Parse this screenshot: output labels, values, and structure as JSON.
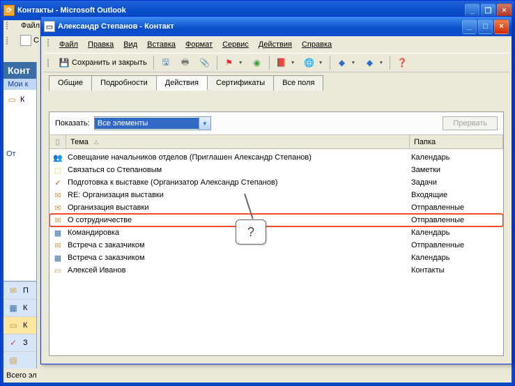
{
  "bg": {
    "title": "Контакты - Microsoft Outlook",
    "menu_file": "Файл",
    "toolbar_btn": "С",
    "side_header": "Конт",
    "side_sub": "Мои к",
    "side_item1": "К",
    "side_current": "От",
    "nav": {
      "mail": "П",
      "cal": "К",
      "contacts": "К",
      "tasks": "З"
    },
    "status": "Всего эл"
  },
  "dlg": {
    "title": "Александр Степанов - Контакт",
    "menu": {
      "file": "Файл",
      "edit": "Правка",
      "view": "Вид",
      "insert": "Вставка",
      "format": "Формат",
      "service": "Сервис",
      "actions": "Действия",
      "help": "Справка"
    },
    "toolbar": {
      "save_close": "Сохранить и закрыть"
    },
    "tabs": {
      "general": "Общие",
      "details": "Подробности",
      "actions": "Действия",
      "certs": "Сертификаты",
      "all": "Все поля"
    },
    "filter": {
      "label": "Показать:",
      "value": "Все элементы",
      "stop": "Прервать"
    },
    "headers": {
      "subject": "Тема",
      "folder": "Папка"
    },
    "rows": [
      {
        "icon": "meeting",
        "subject": "Совещание начальников отделов (Приглашен Александр Степанов)",
        "folder": "Календарь"
      },
      {
        "icon": "note",
        "subject": "Связаться со Степановым",
        "folder": "Заметки"
      },
      {
        "icon": "task",
        "subject": "Подготовка к выставке (Организатор Александр Степанов)",
        "folder": "Задачи"
      },
      {
        "icon": "mail-in",
        "subject": "RE: Организация выставки",
        "folder": "Входящие"
      },
      {
        "icon": "mail-out",
        "subject": "Организация выставки",
        "folder": "Отправленные"
      },
      {
        "icon": "mail-out",
        "subject": "О сотрудничестве",
        "folder": "Отправленные",
        "highlight": true
      },
      {
        "icon": "calendar",
        "subject": "Командировка",
        "folder": "Календарь"
      },
      {
        "icon": "mail-out",
        "subject": "Встреча с заказчиком",
        "folder": "Отправленные"
      },
      {
        "icon": "calendar",
        "subject": "Встреча с заказчиком",
        "folder": "Календарь"
      },
      {
        "icon": "contact",
        "subject": "Алексей Иванов",
        "folder": "Контакты"
      }
    ],
    "callout": "?"
  }
}
